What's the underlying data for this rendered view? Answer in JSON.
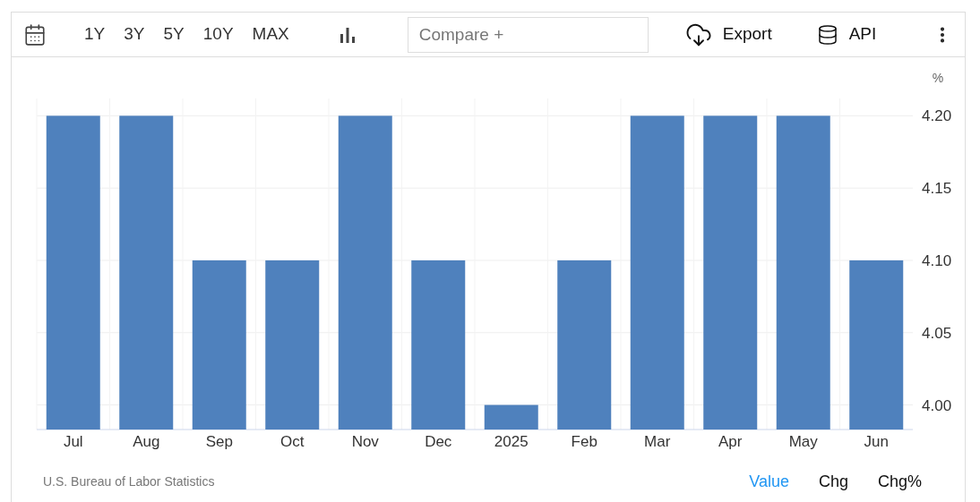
{
  "toolbar": {
    "ranges": [
      "1Y",
      "3Y",
      "5Y",
      "10Y",
      "MAX"
    ],
    "compare": {
      "placeholder": "Compare +"
    },
    "actions": [
      {
        "kind": "export",
        "label": "Export"
      },
      {
        "kind": "api",
        "label": "API"
      }
    ]
  },
  "chart": {
    "chart_data": {
      "type": "bar",
      "ylabel": "%",
      "categories": [
        "Jul",
        "Aug",
        "Sep",
        "Oct",
        "Nov",
        "Dec",
        "2025",
        "Feb",
        "Mar",
        "Apr",
        "May",
        "Jun"
      ],
      "grid": true,
      "series": [
        {
          "color": "#4f81bd",
          "values": [
            4.2,
            4.2,
            4.1,
            4.1,
            4.2,
            4.1,
            4.0,
            4.1,
            4.2,
            4.2,
            4.2,
            4.1
          ]
        }
      ],
      "ylim": [
        3.983,
        4.212
      ],
      "yticks": [
        {
          "value": 4.0,
          "label": "4.00"
        },
        {
          "value": 4.05,
          "label": "4.05"
        },
        {
          "value": 4.1,
          "label": "4.10"
        },
        {
          "value": 4.15,
          "label": "4.15"
        },
        {
          "value": 4.2,
          "label": "4.20"
        }
      ]
    }
  },
  "footer": {
    "source": "U.S. Bureau of Labor Statistics",
    "views": [
      {
        "label": "Value",
        "selected": true
      },
      {
        "label": "Chg",
        "selected": false
      },
      {
        "label": "Chg%",
        "selected": false
      }
    ]
  }
}
